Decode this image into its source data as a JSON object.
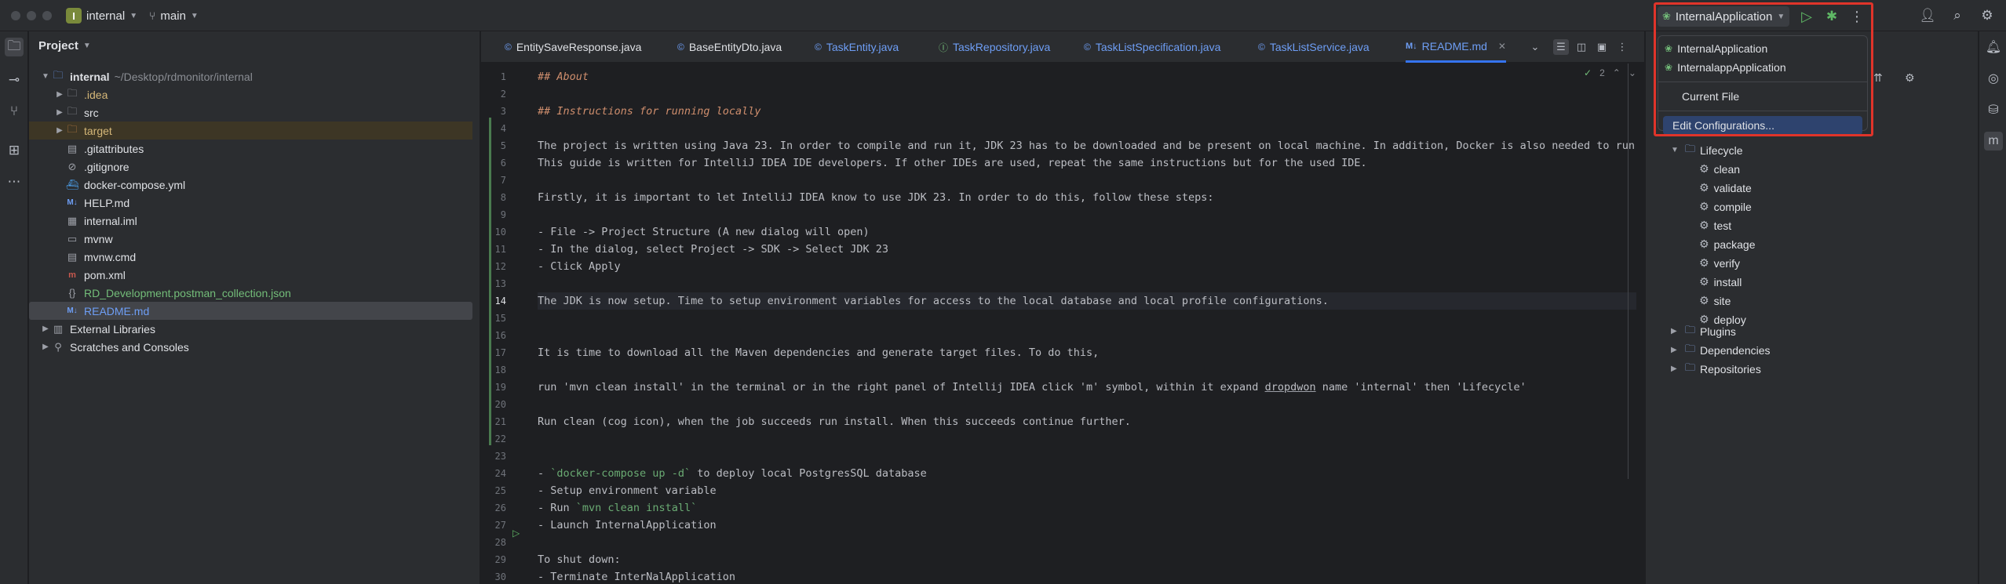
{
  "titlebar": {
    "project_badge": "I",
    "project_name": "internal",
    "branch": "main"
  },
  "run": {
    "current_config": "InternalApplication",
    "dropdown_items": [
      {
        "label": "InternalApplication",
        "icon": "spring-run-icon"
      },
      {
        "label": "InternalappApplication",
        "icon": "spring-run-icon"
      },
      {
        "label": "Current File",
        "icon": ""
      },
      {
        "label": "Edit Configurations...",
        "icon": "",
        "selected": true
      }
    ]
  },
  "project_panel": {
    "title": "Project",
    "root_name": "internal",
    "root_path": "~/Desktop/rdmonitor/internal",
    "items": [
      {
        "label": ".idea",
        "icon": "folder-icon",
        "expandable": true
      },
      {
        "label": "src",
        "icon": "folder-icon",
        "expandable": true
      },
      {
        "label": "target",
        "icon": "folder-icon",
        "expandable": true
      },
      {
        "label": ".gitattributes",
        "icon": "file-icon"
      },
      {
        "label": ".gitignore",
        "icon": "ignore-icon"
      },
      {
        "label": "docker-compose.yml",
        "icon": "docker-icon"
      },
      {
        "label": "HELP.md",
        "icon": "markdown-icon"
      },
      {
        "label": "internal.iml",
        "icon": "iml-icon"
      },
      {
        "label": "mvnw",
        "icon": "script-icon"
      },
      {
        "label": "mvnw.cmd",
        "icon": "file-icon"
      },
      {
        "label": "pom.xml",
        "icon": "maven-icon"
      },
      {
        "label": "RD_Development.postman_collection.json",
        "icon": "json-icon"
      },
      {
        "label": "README.md",
        "icon": "markdown-icon",
        "selected": true
      }
    ],
    "external_libraries": "External Libraries",
    "scratches": "Scratches and Consoles"
  },
  "tabs": [
    {
      "label": "EntitySaveResponse.java"
    },
    {
      "label": "BaseEntityDto.java"
    },
    {
      "label": "TaskEntity.java"
    },
    {
      "label": "TaskRepository.java"
    },
    {
      "label": "TaskListSpecification.java"
    },
    {
      "label": "TaskListService.java"
    },
    {
      "label": "README.md",
      "active": true
    }
  ],
  "editor": {
    "inspection_count": "2",
    "current_line": 14,
    "lines": [
      "## About",
      "",
      "## Instructions for running locally",
      "",
      "The project is written using Java 23. In order to compile and run it, JDK 23 has to be downloaded and be present on local machine. In addition, Docker is also needed to run local Po",
      "This guide is written for IntelliJ IDEA IDE developers. If other IDEs are used, repeat the same instructions but for the used IDE.",
      "",
      "Firstly, it is important to let IntelliJ IDEA know to use JDK 23. In order to do this, follow these steps:",
      "",
      "- File -> Project Structure (A new dialog will open)",
      "- In the dialog, select Project -> SDK -> Select JDK 23",
      "- Click Apply",
      "",
      "The JDK is now setup. Time to setup environment variables for access to the local database and local profile configurations.",
      "",
      "",
      "It is time to download all the Maven dependencies and generate target files. To do this,",
      "",
      "run 'mvn clean install' in the terminal or in the right panel of Intellij IDEA click 'm' symbol, within it expand dropdwon name 'internal' then 'Lifecycle'",
      "",
      "Run clean (cog icon), when the job succeeds run install. When this succeeds continue further.",
      "",
      "",
      "- `docker-compose up -d` to deploy local PostgresSQL database",
      "- Setup environment variable",
      "- Run `mvn clean install`",
      "- Launch InternalApplication",
      "",
      "To shut down:",
      "- Terminate InterNalApplication"
    ]
  },
  "maven_panel": {
    "lifecycle_label": "Lifecycle",
    "lifecycle_items": [
      "clean",
      "validate",
      "compile",
      "test",
      "package",
      "verify",
      "install",
      "site",
      "deploy"
    ],
    "groups": [
      "Plugins",
      "Dependencies",
      "Repositories"
    ]
  },
  "colors": {
    "accent": "#3574f0",
    "highlight_border": "#e0342a",
    "run_green": "#5fb865"
  }
}
